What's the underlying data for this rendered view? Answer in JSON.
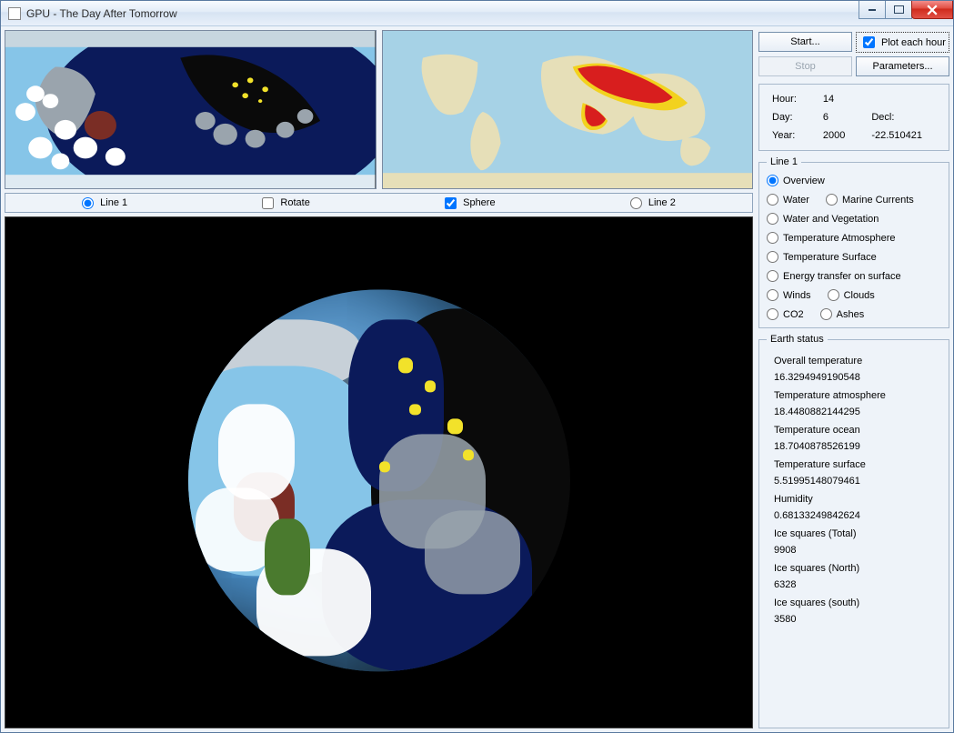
{
  "window": {
    "title": "GPU - The Day After Tomorrow"
  },
  "controls": {
    "start_label": "Start...",
    "stop_label": "Stop",
    "params_label": "Parameters...",
    "plot_each_hour_label": "Plot each hour",
    "plot_each_hour_checked": true
  },
  "time_info": {
    "hour_label": "Hour:",
    "hour_value": "14",
    "day_label": "Day:",
    "day_value": "6",
    "year_label": "Year:",
    "year_value": "2000",
    "decl_label": "Decl:",
    "decl_value": "-22.510421"
  },
  "view_options": {
    "line1_label": "Line 1",
    "rotate_label": "Rotate",
    "sphere_label": "Sphere",
    "line2_label": "Line 2",
    "sphere_checked": true,
    "line_selected": "line1"
  },
  "line1_group": {
    "legend": "Line 1",
    "selected": "overview",
    "options": {
      "overview": "Overview",
      "water": "Water",
      "marine_currents": "Marine Currents",
      "water_and_vegetation": "Water and Vegetation",
      "temp_atmosphere": "Temperature Atmosphere",
      "temp_surface": "Temperature Surface",
      "energy_transfer": "Energy transfer on surface",
      "winds": "Winds",
      "clouds": "Clouds",
      "co2": "CO2",
      "ashes": "Ashes"
    }
  },
  "earth_status": {
    "legend": "Earth status",
    "items": [
      {
        "label": "Overall temperature",
        "value": "16.3294949190548"
      },
      {
        "label": "Temperature atmosphere",
        "value": "18.4480882144295"
      },
      {
        "label": "Temperature ocean",
        "value": "18.7040878526199"
      },
      {
        "label": "Temperature surface",
        "value": "5.51995148079461"
      },
      {
        "label": "Humidity",
        "value": "0.68133249842624"
      },
      {
        "label": "Ice squares (Total)",
        "value": "9908"
      },
      {
        "label": "Ice squares (North)",
        "value": "6328"
      },
      {
        "label": "Ice squares (south)",
        "value": "3580"
      }
    ]
  },
  "colors": {
    "ocean_day": "#86c5e8",
    "ocean_night": "#0b1a5a",
    "land_night": "#0a0a0a",
    "cloud": "#ffffff",
    "cloud_gray": "#9aa4ad",
    "city_lights": "#f2e22a",
    "volcanic": "#7a2d25",
    "vegetation": "#4a7a2e",
    "ice": "#dfeaf2",
    "hotspot_red": "#d81e1e",
    "hotspot_yellow": "#f2d21e"
  }
}
